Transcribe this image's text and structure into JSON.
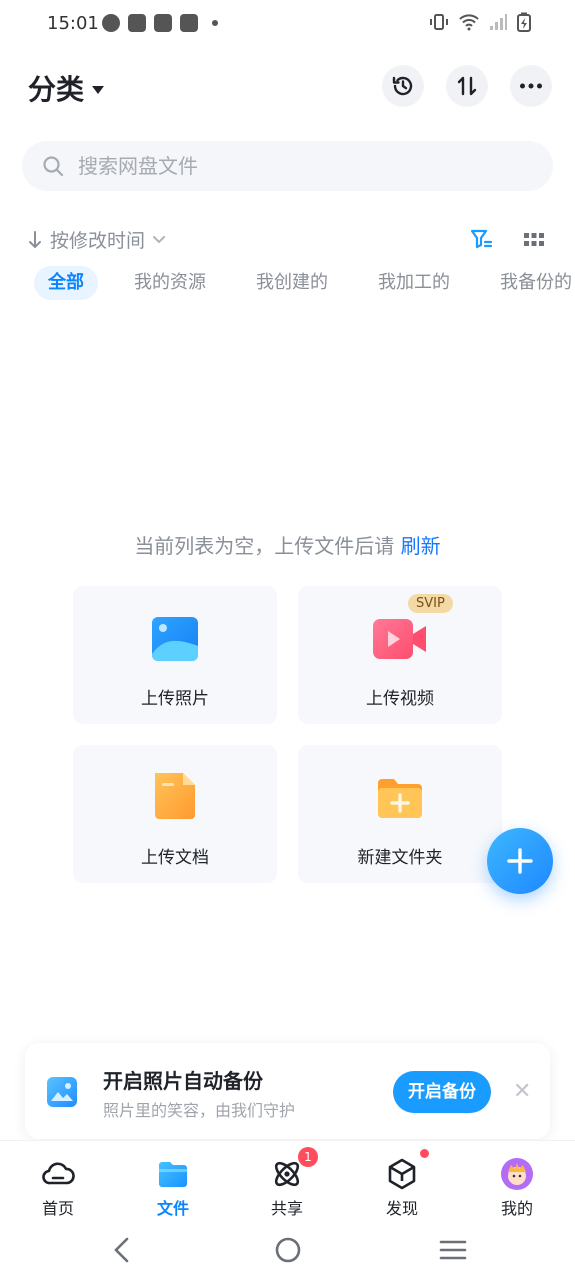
{
  "status_bar": {
    "time": "15:01",
    "left_icons": [
      "speed-icon",
      "shopping-bag-icon",
      "shopping-bag-icon",
      "shopping-bag-icon",
      "dot-icon"
    ],
    "right_icons": [
      "vibrate-icon",
      "wifi-icon",
      "signal-icon",
      "battery-charging-icon"
    ]
  },
  "header": {
    "title": "分类",
    "actions": [
      "history-icon",
      "sort-swap-icon",
      "more-icon"
    ]
  },
  "search": {
    "placeholder": "搜索网盘文件"
  },
  "sort": {
    "label": "按修改时间"
  },
  "tabs": [
    {
      "label": "全部",
      "active": true
    },
    {
      "label": "我的资源",
      "active": false
    },
    {
      "label": "我创建的",
      "active": false
    },
    {
      "label": "我加工的",
      "active": false
    },
    {
      "label": "我备份的",
      "active": false
    }
  ],
  "empty_state": {
    "text": "当前列表为空，上传文件后请",
    "link": "刷新"
  },
  "cards": [
    {
      "label": "上传照片",
      "icon": "photo-icon"
    },
    {
      "label": "上传视频",
      "icon": "video-icon",
      "badge": "SVIP"
    },
    {
      "label": "上传文档",
      "icon": "document-icon"
    },
    {
      "label": "新建文件夹",
      "icon": "folder-add-icon"
    }
  ],
  "backup_banner": {
    "title": "开启照片自动备份",
    "subtitle": "照片里的笑容，由我们守护",
    "button": "开启备份"
  },
  "bottom_nav": [
    {
      "label": "首页",
      "icon": "cloud-icon",
      "active": false
    },
    {
      "label": "文件",
      "icon": "file-folder-icon",
      "active": true
    },
    {
      "label": "共享",
      "icon": "atom-icon",
      "active": false,
      "badge": "1"
    },
    {
      "label": "发现",
      "icon": "cube-icon",
      "active": false,
      "dot": true
    },
    {
      "label": "我的",
      "icon": "avatar-icon",
      "active": false
    }
  ],
  "colors": {
    "accent": "#0A84FF",
    "fab": "#1E88FF",
    "badge": "#FF4D5E"
  }
}
